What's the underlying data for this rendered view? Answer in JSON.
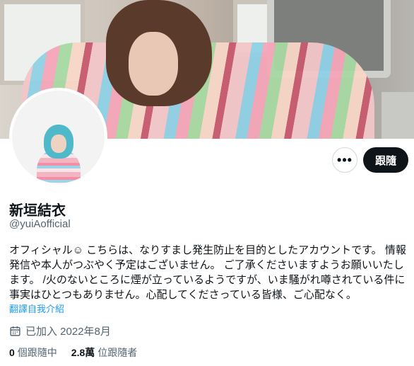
{
  "profile": {
    "name": "新垣結衣",
    "handle": "@yuiAofficial",
    "bio": "オフィシャル☺︎ こちらは、なりすまし発生防止を目的としたアカウントです。 情報発信や本人がつぶやく予定はございません。 ご了承くださいますようお願いいたします。 /火のないところに煙が立っているようですが、いま騒がれ噂されている件に事実はひとつもありません。心配してくださっている皆様、ご心配なく。",
    "translate_label": "翻譯自我介紹",
    "joined": "已加入 2022年8月"
  },
  "actions": {
    "more_label": "•••",
    "follow_label": "跟隨"
  },
  "stats": {
    "following_count": "0",
    "following_label": "個跟隨中",
    "followers_count": "2.8萬",
    "followers_label": "位跟隨者"
  },
  "icons": {
    "calendar": "calendar-icon",
    "more": "more-icon"
  },
  "colors": {
    "accent": "#1d9bf0",
    "button_dark": "#0f1419",
    "secondary_text": "#536471"
  }
}
